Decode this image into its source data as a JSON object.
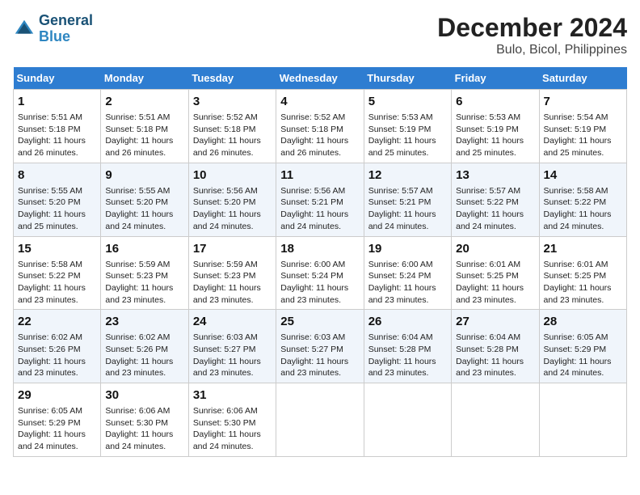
{
  "header": {
    "logo_line1": "General",
    "logo_line2": "Blue",
    "title": "December 2024",
    "subtitle": "Bulo, Bicol, Philippines"
  },
  "days_of_week": [
    "Sunday",
    "Monday",
    "Tuesday",
    "Wednesday",
    "Thursday",
    "Friday",
    "Saturday"
  ],
  "weeks": [
    [
      {
        "day": "1",
        "info": "Sunrise: 5:51 AM\nSunset: 5:18 PM\nDaylight: 11 hours\nand 26 minutes."
      },
      {
        "day": "2",
        "info": "Sunrise: 5:51 AM\nSunset: 5:18 PM\nDaylight: 11 hours\nand 26 minutes."
      },
      {
        "day": "3",
        "info": "Sunrise: 5:52 AM\nSunset: 5:18 PM\nDaylight: 11 hours\nand 26 minutes."
      },
      {
        "day": "4",
        "info": "Sunrise: 5:52 AM\nSunset: 5:18 PM\nDaylight: 11 hours\nand 26 minutes."
      },
      {
        "day": "5",
        "info": "Sunrise: 5:53 AM\nSunset: 5:19 PM\nDaylight: 11 hours\nand 25 minutes."
      },
      {
        "day": "6",
        "info": "Sunrise: 5:53 AM\nSunset: 5:19 PM\nDaylight: 11 hours\nand 25 minutes."
      },
      {
        "day": "7",
        "info": "Sunrise: 5:54 AM\nSunset: 5:19 PM\nDaylight: 11 hours\nand 25 minutes."
      }
    ],
    [
      {
        "day": "8",
        "info": "Sunrise: 5:55 AM\nSunset: 5:20 PM\nDaylight: 11 hours\nand 25 minutes."
      },
      {
        "day": "9",
        "info": "Sunrise: 5:55 AM\nSunset: 5:20 PM\nDaylight: 11 hours\nand 24 minutes."
      },
      {
        "day": "10",
        "info": "Sunrise: 5:56 AM\nSunset: 5:20 PM\nDaylight: 11 hours\nand 24 minutes."
      },
      {
        "day": "11",
        "info": "Sunrise: 5:56 AM\nSunset: 5:21 PM\nDaylight: 11 hours\nand 24 minutes."
      },
      {
        "day": "12",
        "info": "Sunrise: 5:57 AM\nSunset: 5:21 PM\nDaylight: 11 hours\nand 24 minutes."
      },
      {
        "day": "13",
        "info": "Sunrise: 5:57 AM\nSunset: 5:22 PM\nDaylight: 11 hours\nand 24 minutes."
      },
      {
        "day": "14",
        "info": "Sunrise: 5:58 AM\nSunset: 5:22 PM\nDaylight: 11 hours\nand 24 minutes."
      }
    ],
    [
      {
        "day": "15",
        "info": "Sunrise: 5:58 AM\nSunset: 5:22 PM\nDaylight: 11 hours\nand 23 minutes."
      },
      {
        "day": "16",
        "info": "Sunrise: 5:59 AM\nSunset: 5:23 PM\nDaylight: 11 hours\nand 23 minutes."
      },
      {
        "day": "17",
        "info": "Sunrise: 5:59 AM\nSunset: 5:23 PM\nDaylight: 11 hours\nand 23 minutes."
      },
      {
        "day": "18",
        "info": "Sunrise: 6:00 AM\nSunset: 5:24 PM\nDaylight: 11 hours\nand 23 minutes."
      },
      {
        "day": "19",
        "info": "Sunrise: 6:00 AM\nSunset: 5:24 PM\nDaylight: 11 hours\nand 23 minutes."
      },
      {
        "day": "20",
        "info": "Sunrise: 6:01 AM\nSunset: 5:25 PM\nDaylight: 11 hours\nand 23 minutes."
      },
      {
        "day": "21",
        "info": "Sunrise: 6:01 AM\nSunset: 5:25 PM\nDaylight: 11 hours\nand 23 minutes."
      }
    ],
    [
      {
        "day": "22",
        "info": "Sunrise: 6:02 AM\nSunset: 5:26 PM\nDaylight: 11 hours\nand 23 minutes."
      },
      {
        "day": "23",
        "info": "Sunrise: 6:02 AM\nSunset: 5:26 PM\nDaylight: 11 hours\nand 23 minutes."
      },
      {
        "day": "24",
        "info": "Sunrise: 6:03 AM\nSunset: 5:27 PM\nDaylight: 11 hours\nand 23 minutes."
      },
      {
        "day": "25",
        "info": "Sunrise: 6:03 AM\nSunset: 5:27 PM\nDaylight: 11 hours\nand 23 minutes."
      },
      {
        "day": "26",
        "info": "Sunrise: 6:04 AM\nSunset: 5:28 PM\nDaylight: 11 hours\nand 23 minutes."
      },
      {
        "day": "27",
        "info": "Sunrise: 6:04 AM\nSunset: 5:28 PM\nDaylight: 11 hours\nand 23 minutes."
      },
      {
        "day": "28",
        "info": "Sunrise: 6:05 AM\nSunset: 5:29 PM\nDaylight: 11 hours\nand 24 minutes."
      }
    ],
    [
      {
        "day": "29",
        "info": "Sunrise: 6:05 AM\nSunset: 5:29 PM\nDaylight: 11 hours\nand 24 minutes."
      },
      {
        "day": "30",
        "info": "Sunrise: 6:06 AM\nSunset: 5:30 PM\nDaylight: 11 hours\nand 24 minutes."
      },
      {
        "day": "31",
        "info": "Sunrise: 6:06 AM\nSunset: 5:30 PM\nDaylight: 11 hours\nand 24 minutes."
      },
      {
        "day": "",
        "info": ""
      },
      {
        "day": "",
        "info": ""
      },
      {
        "day": "",
        "info": ""
      },
      {
        "day": "",
        "info": ""
      }
    ]
  ]
}
